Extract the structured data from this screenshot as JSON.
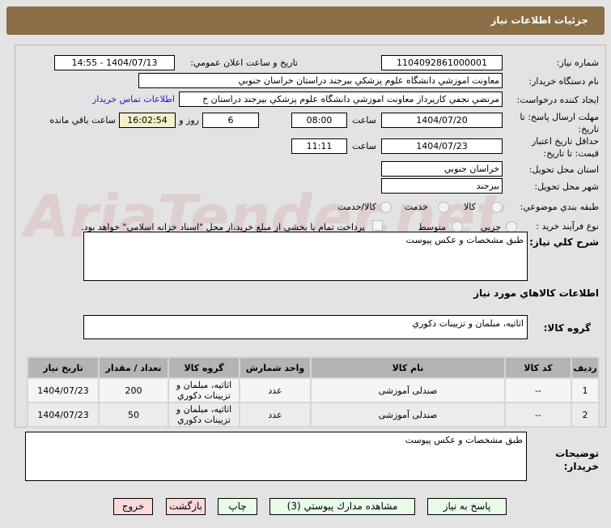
{
  "header": {
    "title": "جزئيات اطلاعات نياز"
  },
  "watermark": "AriaTender.net",
  "fields": {
    "need_number_label": "شماره نياز:",
    "need_number": "1104092861000001",
    "announce_label": "تاريخ و ساعت اعلان عمومي:",
    "announce": "1404/07/13 - 14:55",
    "buyer_label": "نام دستگاه خريدار:",
    "buyer": "معاونت اموزشي دانشگاه علوم پزشكي بيرجند دراستان خراسان جنوبي",
    "creator_label": "ايجاد كننده درخواست:",
    "creator": "مرتضي نجفي كارپرداز معاونت اموزشي دانشگاه علوم پزشكي بيرجند دراستان خ",
    "contact_link": "اطلاعات تماس خريدار",
    "deadline_label": "مهلت ارسال پاسخ: تا تاريخ:",
    "deadline_date": "1404/07/20",
    "time_label": "ساعت",
    "deadline_time": "08:00",
    "days": "6",
    "days_label": "روز و",
    "remaining": "16:02:54",
    "remaining_label": "ساعت باقي مانده",
    "validity_label": "حداقل تاريخ اعتبار قيمت: تا تاريخ:",
    "validity_date": "1404/07/23",
    "validity_time": "11:11",
    "province_label": "استان محل تحويل:",
    "province": "خراسان جنوبي",
    "city_label": "شهر محل تحويل:",
    "city": "بيرجند",
    "category_label": "طبقه بندي موضوعي:",
    "category_options": [
      "كالا",
      "خدمت",
      "كالا/خدمت"
    ],
    "process_label": "نوع فرآيند خريد :",
    "process_options": [
      "جزيي",
      "متوسط"
    ],
    "payment_note": "پرداخت تمام يا بخشي از مبلغ خريد،از محل \"اسناد خزانه اسلامي\" خواهد بود."
  },
  "summary_label": "شرح كلي نياز:",
  "summary": "طبق مشخصات و عكس پيوست",
  "goods_title": "اطلاعات كالاهاي مورد نياز",
  "goods_group_label": "گروه كالا:",
  "goods_group": "اثاثيه، مبلمان و تزيينات دكوري",
  "table": {
    "headers": [
      "رديف",
      "كد كالا",
      "نام كالا",
      "واحد شمارش",
      "گروه كالا",
      "تعداد / مقدار",
      "تاريخ نياز"
    ],
    "rows": [
      [
        "1",
        "--",
        "صندلی آموزشی",
        "عدد",
        "اثاثيه، مبلمان و تزيينات دكوري",
        "200",
        "1404/07/23"
      ],
      [
        "2",
        "--",
        "صندلی آموزشی",
        "عدد",
        "اثاثيه، مبلمان و تزيينات دكوري",
        "50",
        "1404/07/23"
      ]
    ]
  },
  "notes_label": "توضيحات خريدار:",
  "notes": "طبق مشخصات و عكس پيوست",
  "buttons": {
    "reply": "پاسخ به نياز",
    "attachments": "مشاهده مدارك پيوستي (3)",
    "print": "چاپ",
    "back": "بازگشت",
    "exit": "خروج"
  }
}
